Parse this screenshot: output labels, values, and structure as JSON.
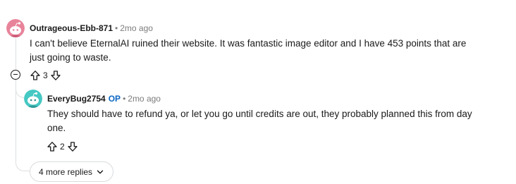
{
  "comment": {
    "author": "Outrageous-Ebb-871",
    "separator": "•",
    "time": "2mo ago",
    "body_line1": "I can't believe EternalAI ruined their website.  It was fantastic image editor and I have 453 points that are",
    "body_line2": "just going to waste.",
    "votes": "3",
    "avatar_color": "#e8849a"
  },
  "reply": {
    "author": "EveryBug2754",
    "op_badge": "OP",
    "separator": "•",
    "time": "2mo ago",
    "body_line1": "They should have to refund ya, or let you go until credits are out, they probably planned this from day",
    "body_line2": "one.",
    "votes": "2",
    "avatar_color": "#46c8c3"
  },
  "more_replies_label": "4 more replies",
  "colors": {
    "op": "#0a66c2",
    "muted": "#7c7c7c",
    "rail": "#dcdfe1"
  }
}
